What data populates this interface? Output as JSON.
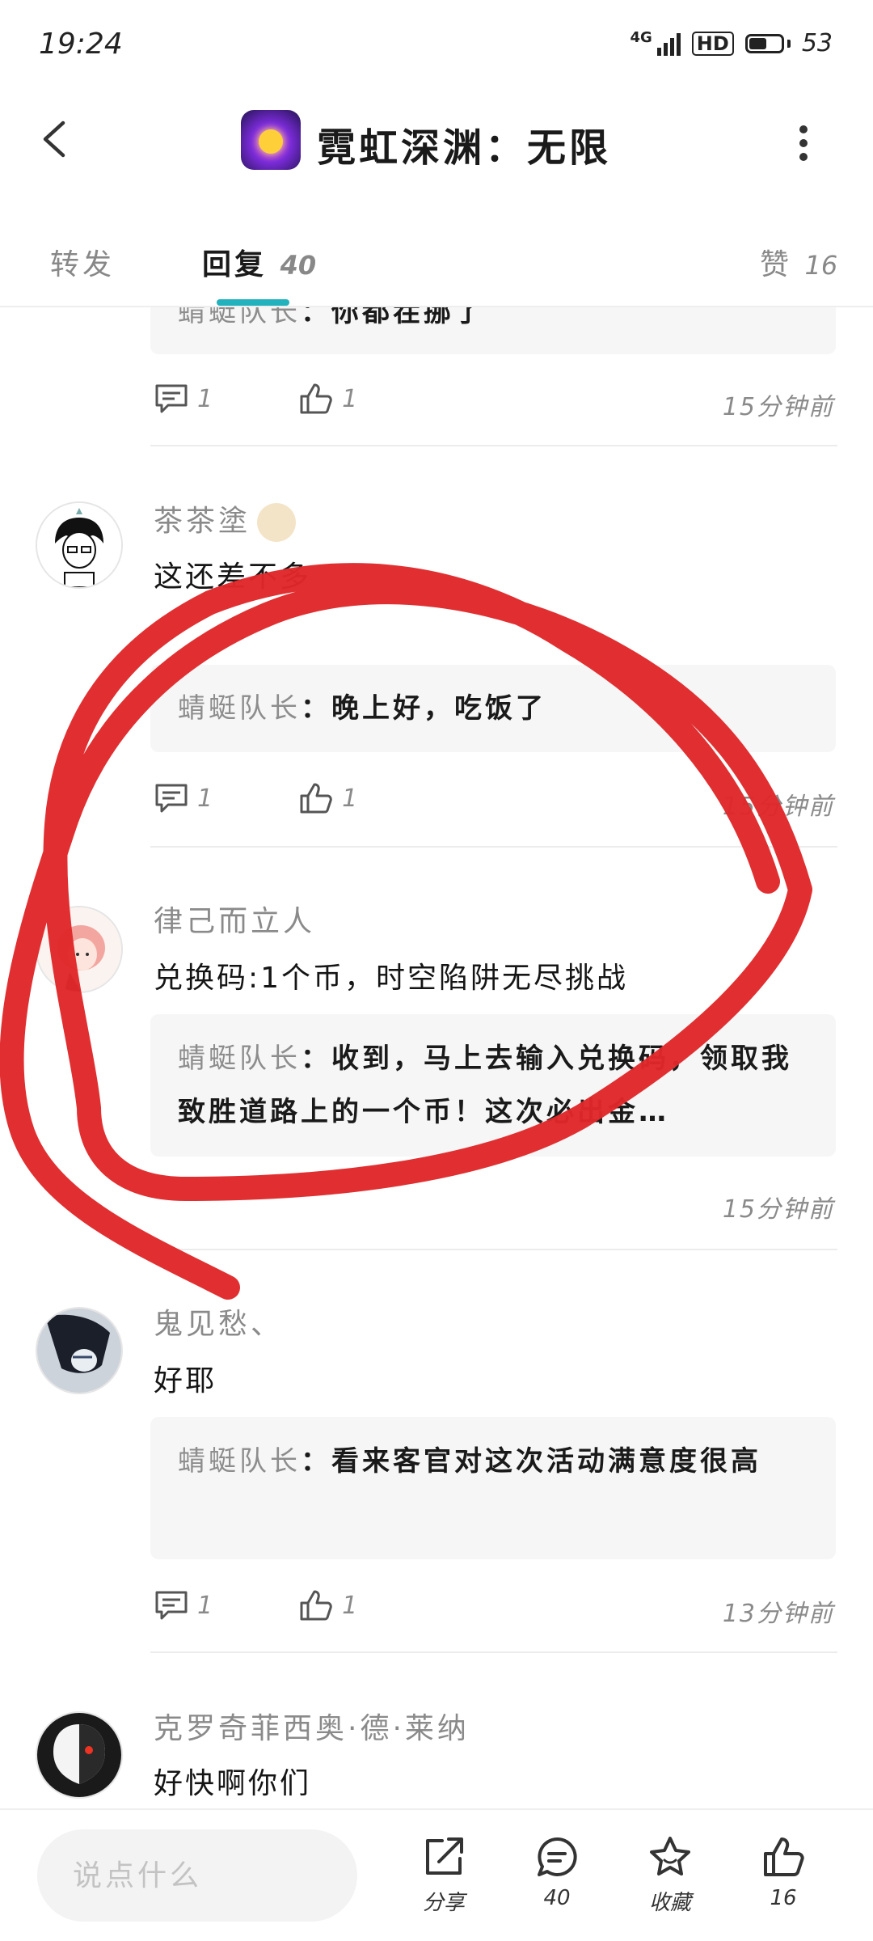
{
  "status_bar": {
    "time": "19:24",
    "network": "4G",
    "hd": "HD",
    "battery": "53"
  },
  "header": {
    "title": "霓虹深渊：无限",
    "app_icon": "game-app-icon"
  },
  "tabs": [
    {
      "label": "转发",
      "count": ""
    },
    {
      "label": "回复",
      "count": "40"
    },
    {
      "label": "赞",
      "count": "16"
    }
  ],
  "comments": [
    {
      "reply": {
        "author": "蜻蜓队长",
        "separator": "：",
        "text": "你都茬挪了"
      },
      "reply_count": "1",
      "like_count": "1",
      "time": "15分钟前"
    },
    {
      "username": "茶茶塗",
      "text": "这还差不多",
      "reply": {
        "author": "蜻蜓队长",
        "separator": "：",
        "text": "晚上好，吃饭了"
      },
      "reply_count": "1",
      "like_count": "1",
      "time": "15分钟前"
    },
    {
      "username": "律己而立人",
      "text": "兑换码:1个币，时空陷阱无尽挑战",
      "reply": {
        "author": "蜻蜓队长",
        "separator": "：",
        "text": "收到，马上去输入兑换码，领取我致胜道路上的一个币！这次必出金…"
      },
      "time": "15分钟前"
    },
    {
      "username": "鬼见愁、",
      "text": "好耶",
      "reply": {
        "author": "蜻蜓队长",
        "separator": "：",
        "text": "看来客官对这次活动满意度很高"
      },
      "reply_count": "1",
      "like_count": "1",
      "time": "13分钟前"
    },
    {
      "username": "克罗奇菲西奥·德·莱纳",
      "text": "好快啊你们"
    }
  ],
  "bottom_bar": {
    "input_placeholder": "说点什么",
    "share_label": "分享",
    "comment_count": "40",
    "favorite_label": "收藏",
    "like_count": "16"
  },
  "colors": {
    "accent": "#22b2bd",
    "annotation": "#e0282a"
  }
}
